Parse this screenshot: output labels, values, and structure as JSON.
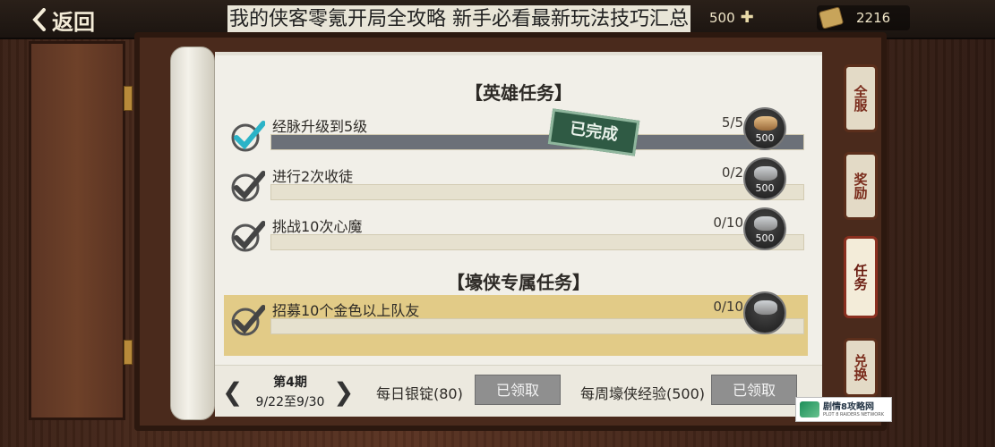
{
  "header": {
    "back_label": "返回",
    "title": "我的侠客零氪开局全攻略 新手必看最新玩法技巧汇总",
    "silver_value": "500",
    "gold_value": "2216"
  },
  "sections": {
    "hero_title": "【英雄任务】",
    "patron_title": "【壕侠专属任务】"
  },
  "tasks": [
    {
      "label": "经脉升级到5级",
      "progress_text": "5/5",
      "progress": 1.0,
      "reward_amount": "500",
      "completed": true
    },
    {
      "label": "进行2次收徒",
      "progress_text": "0/2",
      "progress": 0.0,
      "reward_amount": "500",
      "completed": false
    },
    {
      "label": "挑战10次心魔",
      "progress_text": "0/10",
      "progress": 0.0,
      "reward_amount": "500",
      "completed": false
    },
    {
      "label": "招募10个金色以上队友",
      "progress_text": "0/10",
      "progress": 0.0,
      "reward_amount": "",
      "completed": false
    }
  ],
  "stamp_text": "已完成",
  "footer": {
    "period_title": "第4期",
    "period_range": "9/22至9/30",
    "daily_label": "每日银锭(80)",
    "daily_button": "已领取",
    "weekly_label": "每周壕侠经验(500)",
    "weekly_button": "已领取"
  },
  "side_tabs": [
    {
      "label": "全服",
      "active": false
    },
    {
      "label": "奖励",
      "active": false
    },
    {
      "label": "任务",
      "active": true
    },
    {
      "label": "兑换",
      "active": false
    }
  ],
  "watermark": {
    "name": "剧情8攻略网",
    "sub": "PLOT 8 RAIDERS NETWORK"
  },
  "colors": {
    "highlight_row": "#dfc476",
    "completed_bar": "#6b7078",
    "stamp_bg": "#2f5a44"
  }
}
